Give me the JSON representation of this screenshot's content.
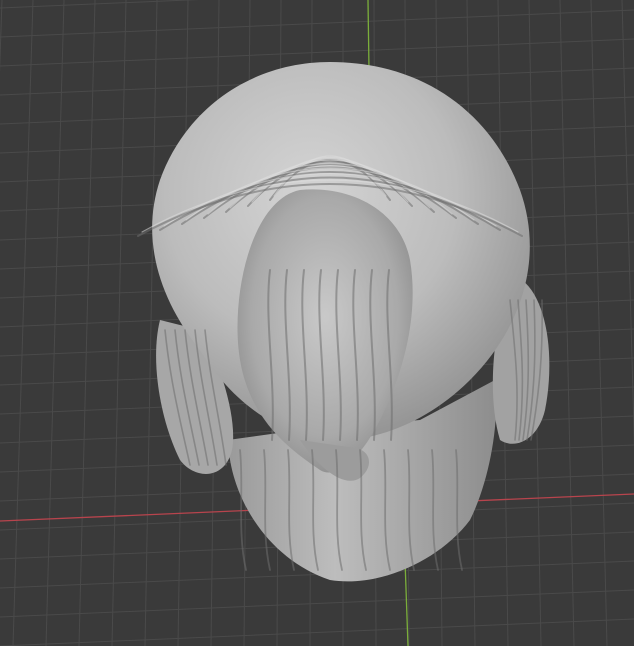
{
  "viewport": {
    "background_color": "#3a3a3a",
    "grid_line_color": "#4a4a4a",
    "x_axis_color": "#b8444d",
    "y_axis_color": "#7bae3a",
    "sculpt_base_color": "#bdbdbd",
    "sculpt_shadow_color": "#6e6e6e",
    "sculpt_highlight_color": "#dedede"
  }
}
